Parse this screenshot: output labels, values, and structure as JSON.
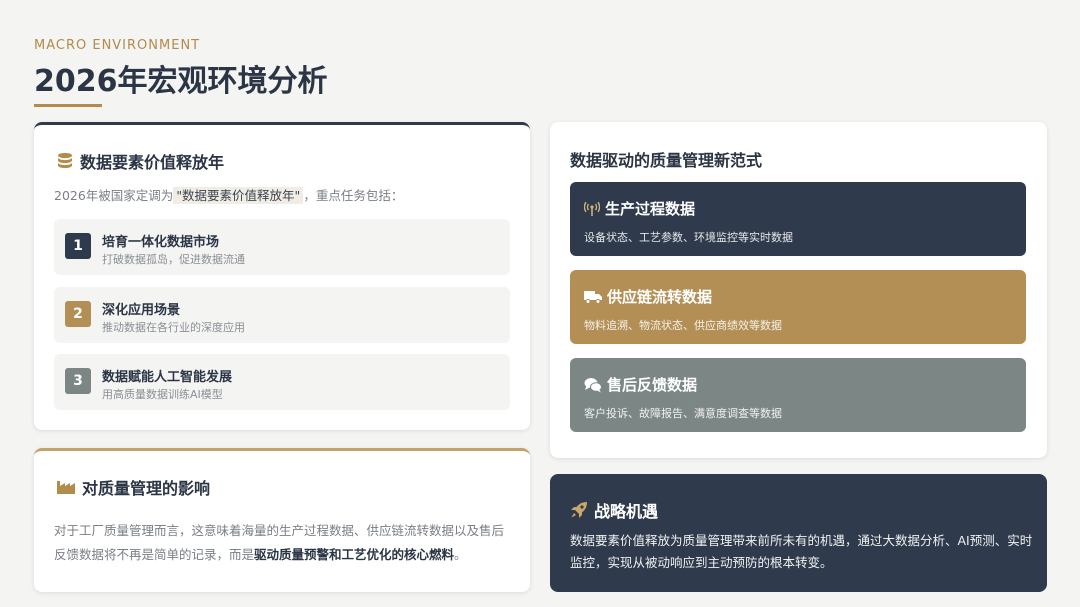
{
  "header": {
    "eyebrow": "MACRO ENVIRONMENT",
    "title": "2026年宏观环境分析"
  },
  "colors": {
    "accent_gold": "#b38b4a",
    "dark_navy": "#2f3b4d",
    "gold_block": "#b38f55",
    "gray_block": "#7c8785"
  },
  "data_year_card": {
    "icon": "database-icon",
    "title": "数据要素价值释放年",
    "intro_prefix": "2026年被国家定调为",
    "intro_highlight": "\"数据要素价值释放年\"",
    "intro_suffix": "，重点任务包括：",
    "tasks": [
      {
        "num": "1",
        "title": "培育一体化数据市场",
        "desc": "打破数据孤岛，促进数据流通"
      },
      {
        "num": "2",
        "title": "深化应用场景",
        "desc": "推动数据在各行业的深度应用"
      },
      {
        "num": "3",
        "title": "数据赋能人工智能发展",
        "desc": "用高质量数据训练AI模型"
      }
    ]
  },
  "impact_card": {
    "icon": "factory-icon",
    "title": "对质量管理的影响",
    "text_prefix": "对于工厂质量管理而言，这意味着海量的生产过程数据、供应链流转数据以及售后反馈数据将不再是简单的记录，而是",
    "text_bold": "驱动质量预警和工艺优化的核心燃料",
    "text_suffix": "。"
  },
  "paradigm_card": {
    "title": "数据驱动的质量管理新范式",
    "blocks": [
      {
        "icon": "signal-tower-icon",
        "title": "生产过程数据",
        "desc": "设备状态、工艺参数、环境监控等实时数据"
      },
      {
        "icon": "truck-icon",
        "title": "供应链流转数据",
        "desc": "物料追溯、物流状态、供应商绩效等数据"
      },
      {
        "icon": "chat-bubbles-icon",
        "title": "售后反馈数据",
        "desc": "客户投诉、故障报告、满意度调查等数据"
      }
    ]
  },
  "strategy_card": {
    "icon": "rocket-icon",
    "title": "战略机遇",
    "text": "数据要素价值释放为质量管理带来前所未有的机遇，通过大数据分析、AI预测、实时监控，实现从被动响应到主动预防的根本转变。"
  }
}
